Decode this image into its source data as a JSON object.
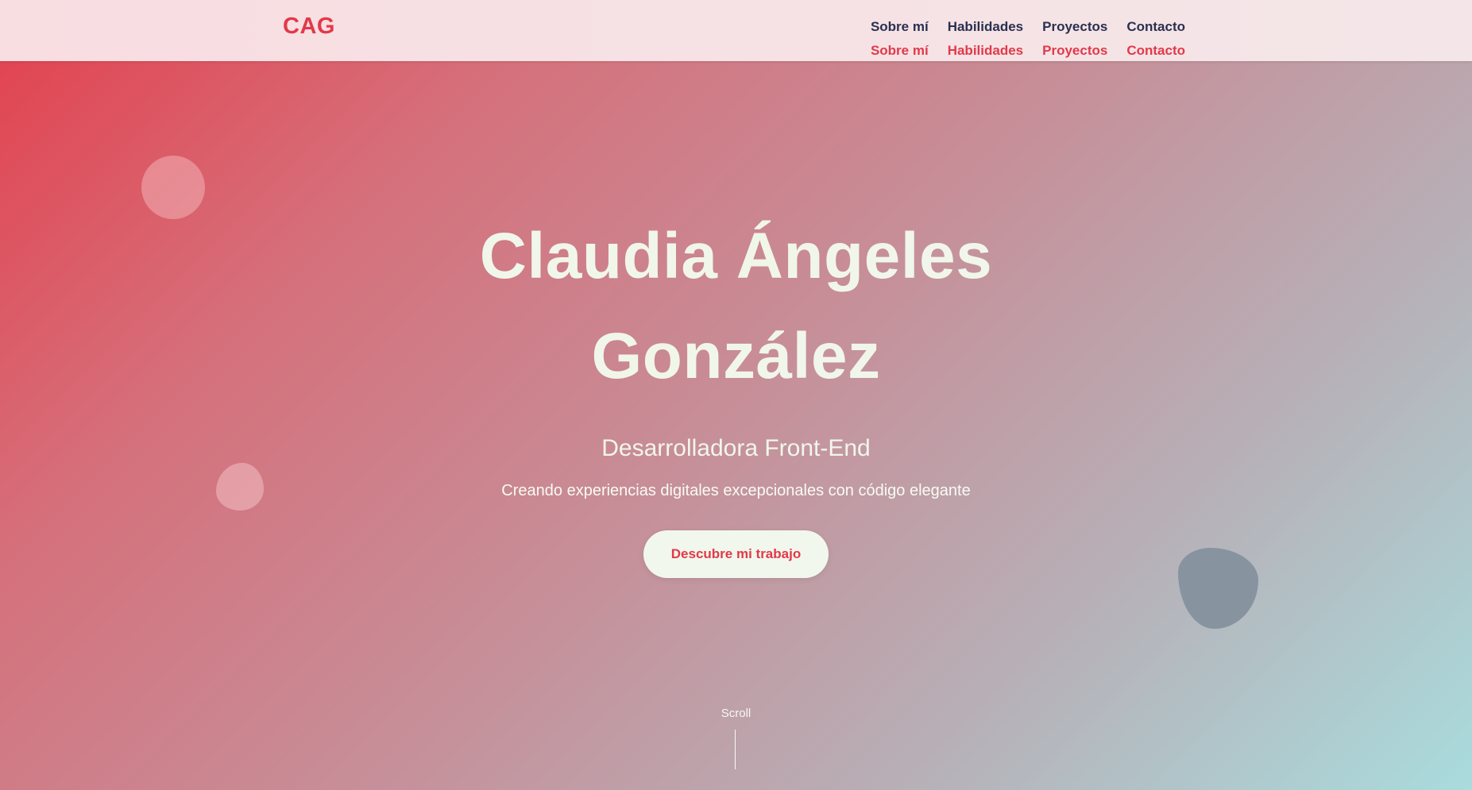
{
  "header": {
    "logo": "CAG",
    "nav": [
      {
        "label": "Sobre mí"
      },
      {
        "label": "Habilidades"
      },
      {
        "label": "Proyectos"
      },
      {
        "label": "Contacto"
      }
    ],
    "nav_duplicate": [
      {
        "label": "Sobre mí"
      },
      {
        "label": "Habilidades"
      },
      {
        "label": "Proyectos"
      },
      {
        "label": "Contacto"
      }
    ]
  },
  "hero": {
    "name_line1": "Claudia Ángeles",
    "name_line2": "González",
    "role": "Desarrolladora Front-End",
    "tagline": "Creando experiencias digitales excepcionales con código elegante",
    "cta_label": "Descubre mi trabajo"
  },
  "scroll": {
    "label": "Scroll"
  },
  "colors": {
    "accent": "#e2394a",
    "nav_text": "#2a3050",
    "hero_text": "#f1f6ea",
    "gradient_start": "#e3404d",
    "gradient_end": "#a9dcdd"
  }
}
